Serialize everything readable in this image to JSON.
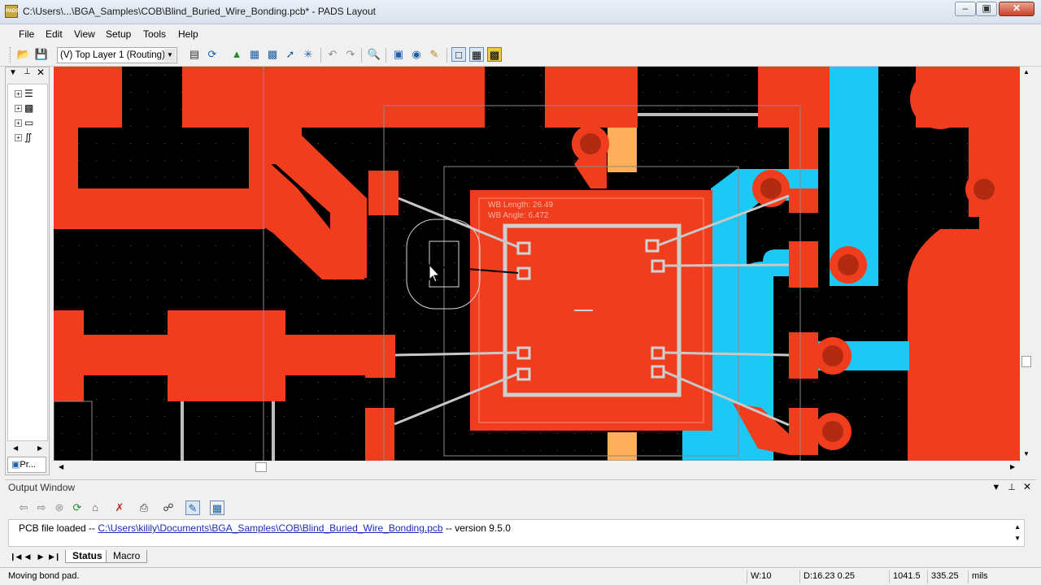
{
  "window": {
    "title": "C:\\Users\\...\\BGA_Samples\\COB\\Blind_Buried_Wire_Bonding.pcb* - PADS Layout",
    "app_icon_text": "PADS"
  },
  "menu": [
    "File",
    "Edit",
    "View",
    "Setup",
    "Tools",
    "Help"
  ],
  "toolbar": {
    "layer_select": "(V) Top Layer 1 (Routing)"
  },
  "left_panel": {
    "tab_label": "Pr..."
  },
  "canvas": {
    "wb_length_label": "WB Length: 26.49",
    "wb_angle_label": "WB Angle:  6.472",
    "colors": {
      "copper": "#f03d1e",
      "inner_trace": "#1cc8f4",
      "via_pad": "#ffae5a",
      "via_center": "#b22a12",
      "wire": "#c8c8c8",
      "background": "#000000"
    }
  },
  "output_window": {
    "title": "Output Window",
    "message_prefix": "PCB file loaded -- ",
    "message_link": "C:\\Users\\kilily\\Documents\\BGA_Samples\\COB\\Blind_Buried_Wire_Bonding.pcb",
    "message_suffix": " -- version 9.5.0",
    "tabs": [
      "Status",
      "Macro"
    ]
  },
  "status_bar": {
    "message": "Moving bond pad.",
    "width": "W:10",
    "delta": "D:16.23 0.25",
    "x": "1041.5",
    "y": "335.25",
    "units": "mils"
  }
}
